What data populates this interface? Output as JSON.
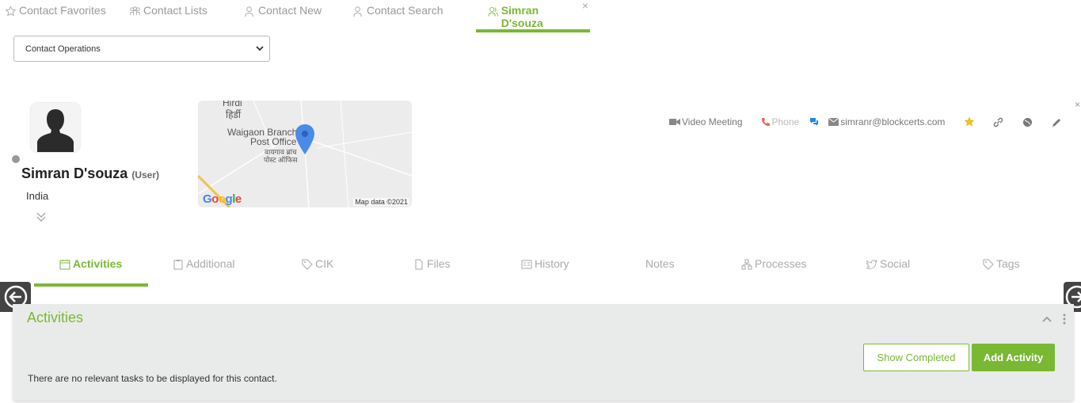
{
  "top_tabs": [
    {
      "label": "Contact Favorites",
      "icon": "star-icon"
    },
    {
      "label": "Contact Lists",
      "icon": "group-icon"
    },
    {
      "label": "Contact New",
      "icon": "user-add-icon"
    },
    {
      "label": "Contact Search",
      "icon": "user-search-icon"
    },
    {
      "label": "Simran D'souza",
      "icon": "user-group-icon",
      "active": true
    }
  ],
  "ops_select": {
    "value": "Contact Operations"
  },
  "contact": {
    "name": "Simran D'souza",
    "role": "(User)",
    "country": "India",
    "status_color": "#999999"
  },
  "map": {
    "labels": [
      "Hirdi",
      "हिर्डी",
      "Waigaon Branch",
      "Post Office",
      "वायगाव ब्रांच",
      "पोस्ट ऑफिस"
    ],
    "attribution": "Map data ©2021",
    "logo": "Google"
  },
  "actions": {
    "video": "Video Meeting",
    "phone": "Phone",
    "email": "simranr@blockcerts.com"
  },
  "close_glyph": "×",
  "section_tabs": [
    {
      "label": "Activities",
      "icon": "calendar-icon",
      "active": true
    },
    {
      "label": "Additional",
      "icon": "clipboard-icon"
    },
    {
      "label": "CIK",
      "icon": "tag-icon"
    },
    {
      "label": "Files",
      "icon": "file-icon"
    },
    {
      "label": "History",
      "icon": "history-card-icon"
    },
    {
      "label": "Notes",
      "icon": ""
    },
    {
      "label": "Processes",
      "icon": "process-icon"
    },
    {
      "label": "Social",
      "icon": "twitter-icon"
    },
    {
      "label": "Tags",
      "icon": "tag-icon"
    }
  ],
  "activities_panel": {
    "title": "Activities",
    "empty_message": "There are no relevant tasks to be displayed for this contact.",
    "show_completed": "Show Completed",
    "add_activity": "Add Activity"
  },
  "colors": {
    "accent": "#7ab833",
    "panel_bg": "#e9ebea"
  }
}
